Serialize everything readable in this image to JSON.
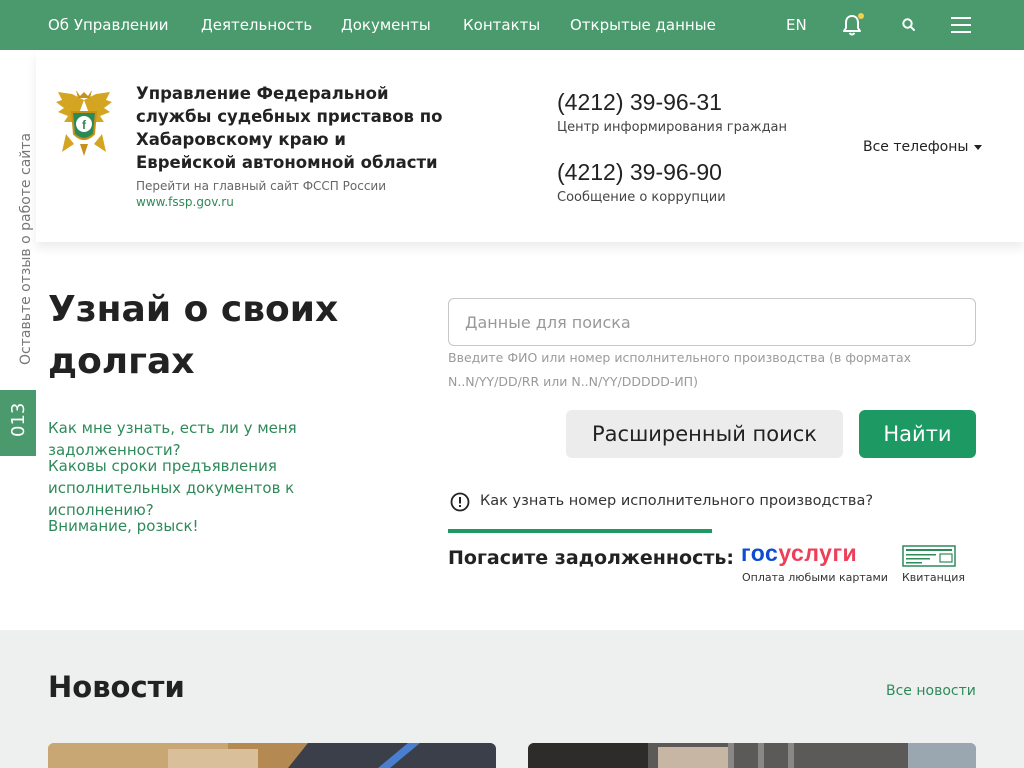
{
  "nav": {
    "items": [
      "Об Управлении",
      "Деятельность",
      "Документы",
      "Контакты",
      "Открытые данные"
    ],
    "lang": "EN"
  },
  "header": {
    "org_name": "Управление Федеральной службы судебных приставов по Хабаровскому краю и Еврейской автономной области",
    "site_hint": "Перейти на главный сайт ФССП России",
    "site_link": "www.fssp.gov.ru",
    "phones": [
      {
        "number": "(4212) 39-96-31",
        "caption": "Центр информирования граждан"
      },
      {
        "number": "(4212) 39-96-90",
        "caption": "Сообщение о коррупции"
      }
    ],
    "all_phones": "Все телефоны"
  },
  "side": {
    "feedback": "Оставьте отзыв о работе сайта",
    "tab_label": "013"
  },
  "hero": {
    "title": "Узнай о своих долгах",
    "faq": [
      "Как мне узнать, есть ли у меня задолженности?",
      "Каковы сроки предъявления исполнительных документов к исполнению?",
      "Внимание, розыск!"
    ]
  },
  "search": {
    "placeholder": "Данные для поиска",
    "hint": "Введите ФИО или номер исполнительного производства (в форматах N..N/YY/DD/RR или N..N/YY/DDDDD-ИП)",
    "advanced_label": "Расширенный поиск",
    "find_label": "Найти",
    "info_link": "Как узнать номер исполнительного производства?"
  },
  "pay": {
    "label": "Погасите задолженность:",
    "gos_part1": "гос",
    "gos_part2": "услуги",
    "gos_caption": "Оплата любыми картами",
    "receipt_caption": "Квитанция"
  },
  "news": {
    "title": "Новости",
    "all_label": "Все новости"
  },
  "colors": {
    "brand_green": "#4a9a6d",
    "button_green": "#1d9a63",
    "link_green": "#2f8a5a",
    "gos_blue": "#0d4cd3",
    "gos_red": "#ee3f58"
  }
}
